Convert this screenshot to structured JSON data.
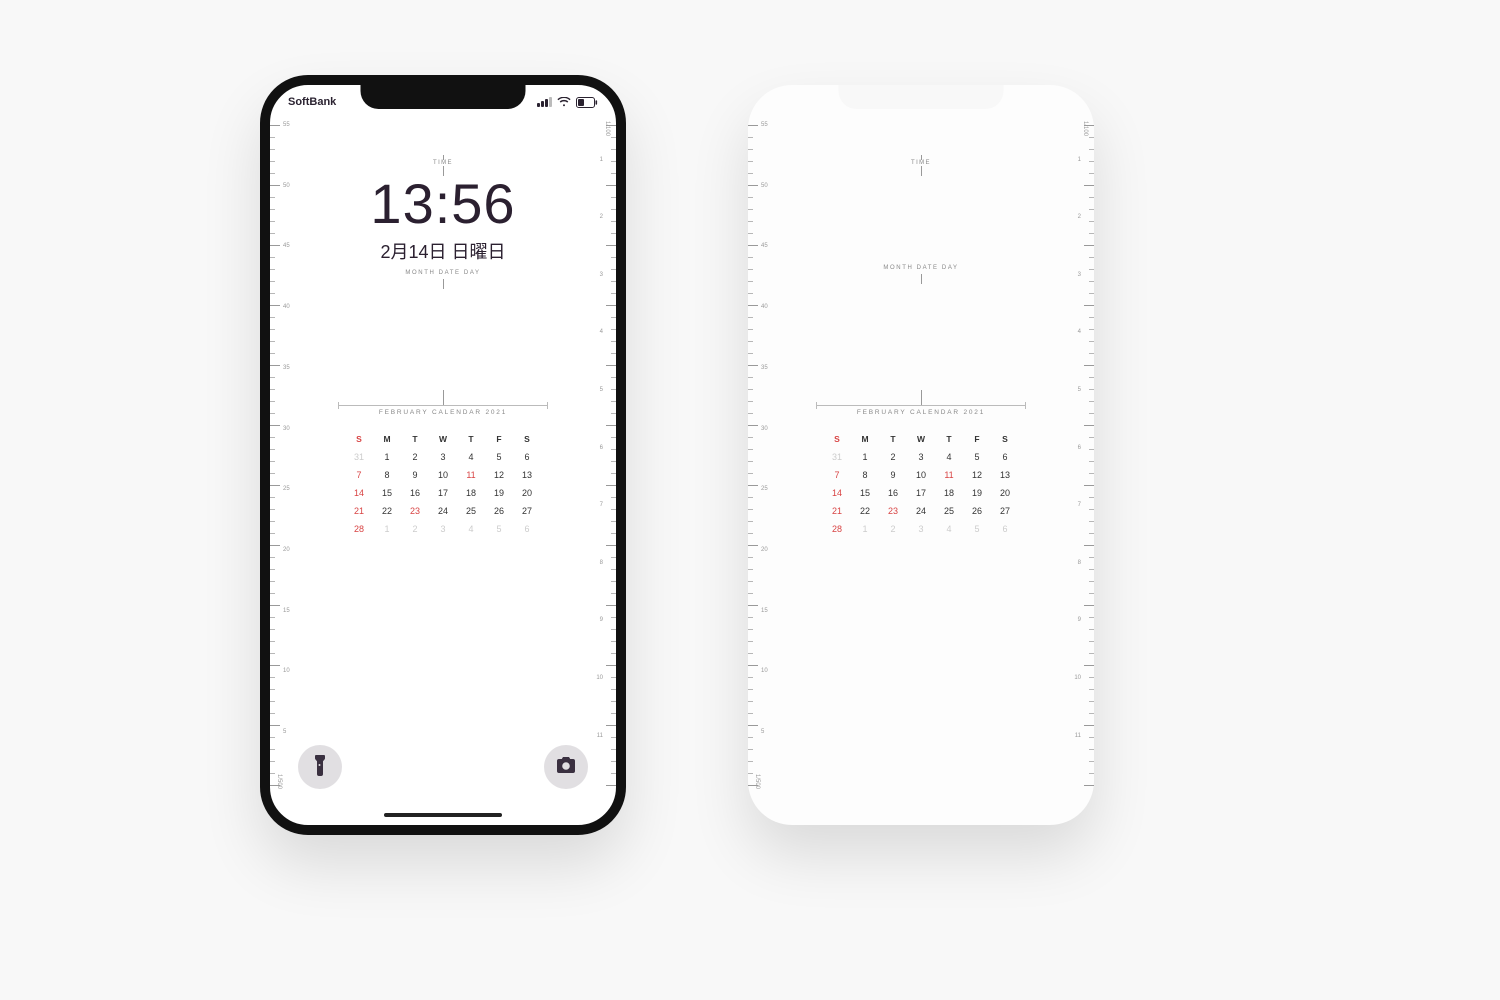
{
  "status": {
    "carrier": "SoftBank"
  },
  "lock": {
    "label_time": "TIME",
    "time": "13:56",
    "date": "2月14日 日曜日",
    "subrow": "MONTH  DATE  DAY"
  },
  "calendar": {
    "title": "FEBRUARY  CALENDAR  2021",
    "dow": [
      "S",
      "M",
      "T",
      "W",
      "T",
      "F",
      "S"
    ],
    "weeks": [
      [
        {
          "n": 31,
          "ghost": true
        },
        {
          "n": 1
        },
        {
          "n": 2
        },
        {
          "n": 3
        },
        {
          "n": 4
        },
        {
          "n": 5
        },
        {
          "n": 6
        }
      ],
      [
        {
          "n": 7,
          "red": true
        },
        {
          "n": 8
        },
        {
          "n": 9
        },
        {
          "n": 10
        },
        {
          "n": 11,
          "red": true
        },
        {
          "n": 12
        },
        {
          "n": 13
        }
      ],
      [
        {
          "n": 14,
          "red": true
        },
        {
          "n": 15
        },
        {
          "n": 16
        },
        {
          "n": 17
        },
        {
          "n": 18
        },
        {
          "n": 19
        },
        {
          "n": 20
        }
      ],
      [
        {
          "n": 21,
          "red": true
        },
        {
          "n": 22
        },
        {
          "n": 23,
          "red": true
        },
        {
          "n": 24
        },
        {
          "n": 25
        },
        {
          "n": 26
        },
        {
          "n": 27
        }
      ],
      [
        {
          "n": 28,
          "red": true
        },
        {
          "n": 1,
          "ghost": true
        },
        {
          "n": 2,
          "ghost": true
        },
        {
          "n": 3,
          "ghost": true
        },
        {
          "n": 4,
          "ghost": true
        },
        {
          "n": 5,
          "ghost": true
        },
        {
          "n": 6,
          "ghost": true
        }
      ]
    ]
  },
  "ruler": {
    "left_top_label": "",
    "left_bottom_label": "1/500",
    "right_top_label": "1/100",
    "right_bottom_label": "",
    "left_numbers": [
      55,
      50,
      45,
      40,
      35,
      30,
      25,
      20,
      15,
      10,
      5
    ],
    "right_numbers": [
      1,
      2,
      3,
      4,
      5,
      6,
      7,
      8,
      9,
      10,
      11
    ]
  }
}
